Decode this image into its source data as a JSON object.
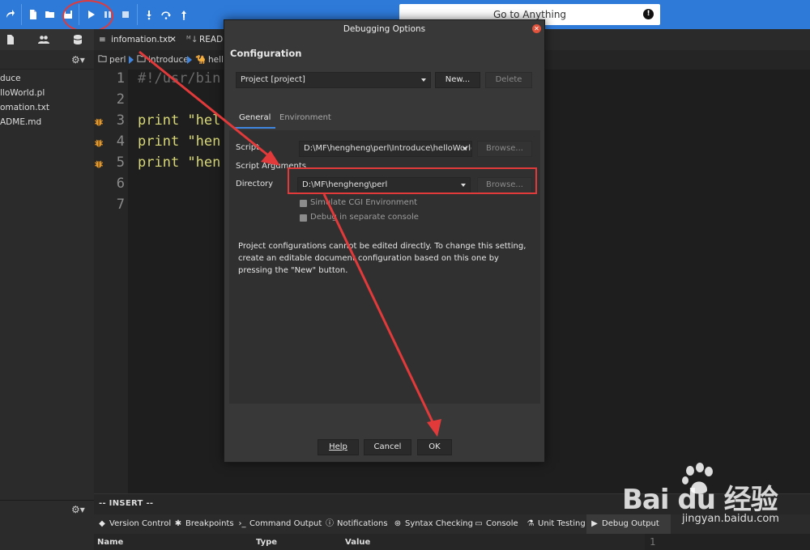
{
  "colors": {
    "accent": "#2e7ad9",
    "annotation_red": "#e23a3a",
    "close_red": "#e0523b",
    "tab_underline": "#3f86e0"
  },
  "toolbar": {
    "search_label": "Go to Anything",
    "icons": [
      "redo-icon",
      "new-file-icon",
      "open-folder-icon",
      "save-icon",
      "play-icon",
      "pause-icon",
      "stop-icon",
      "step-into-icon",
      "step-over-icon",
      "step-out-icon"
    ]
  },
  "sidebar": {
    "items": [
      {
        "label": "duce"
      },
      {
        "label": "lloWorld.pl"
      },
      {
        "label": "omation.txt"
      },
      {
        "label": "ADME.md"
      }
    ]
  },
  "editor": {
    "tabs": [
      {
        "label": "infomation.txt",
        "close": "✕"
      },
      {
        "label": "READM"
      }
    ],
    "breadcrumb": [
      "perl",
      "introduce",
      "hello"
    ],
    "line_numbers": [
      "1",
      "2",
      "3",
      "4",
      "5",
      "6",
      "7"
    ],
    "lines": [
      {
        "text": "#!/usr/bin"
      },
      {
        "text": ""
      },
      {
        "kw": "print",
        "str": " \"hel"
      },
      {
        "kw": "print",
        "str": " \"hen"
      },
      {
        "kw": "print",
        "str": " \"hen"
      }
    ]
  },
  "status": {
    "mode": "-- INSERT --"
  },
  "bottom_panel": {
    "tabs": [
      {
        "label": "Version Control",
        "icon": "version-control-icon"
      },
      {
        "label": "Breakpoints",
        "icon": "breakpoints-icon"
      },
      {
        "label": "Command Output",
        "icon": "command-output-icon"
      },
      {
        "label": "Notifications",
        "icon": "notifications-icon"
      },
      {
        "label": "Syntax Checking",
        "icon": "syntax-checking-icon"
      },
      {
        "label": "Console",
        "icon": "console-icon"
      },
      {
        "label": "Unit Testing",
        "icon": "unit-testing-icon"
      },
      {
        "label": "Debug Output",
        "icon": "debug-output-icon"
      }
    ],
    "columns": [
      "Name",
      "Type",
      "Value"
    ],
    "right_line": "1"
  },
  "dialog": {
    "title": "Debugging Options",
    "heading": "Configuration",
    "config_select": "Project [project]",
    "new_label": "New...",
    "delete_label": "Delete",
    "tabs": [
      "General",
      "Environment"
    ],
    "script_label": "Script",
    "script_value": "D:\\MF\\hengheng\\perl\\Introduce\\helloWorld.",
    "browse_label": "Browse...",
    "args_label": "Script Arguments",
    "directory_label": "Directory",
    "directory_value": "D:\\MF\\hengheng\\perl",
    "simulate_cgi": "Simulate CGI Environment",
    "separate_console": "Debug in separate console",
    "note": "Project configurations cannot be edited directly. To change this setting, create an editable document configuration based on this one by pressing the \"New\" button.",
    "help_label": "Help",
    "cancel_label": "Cancel",
    "ok_label": "OK"
  },
  "watermark": {
    "brand": "Bai du 经验",
    "url": "jingyan.baidu.com"
  }
}
